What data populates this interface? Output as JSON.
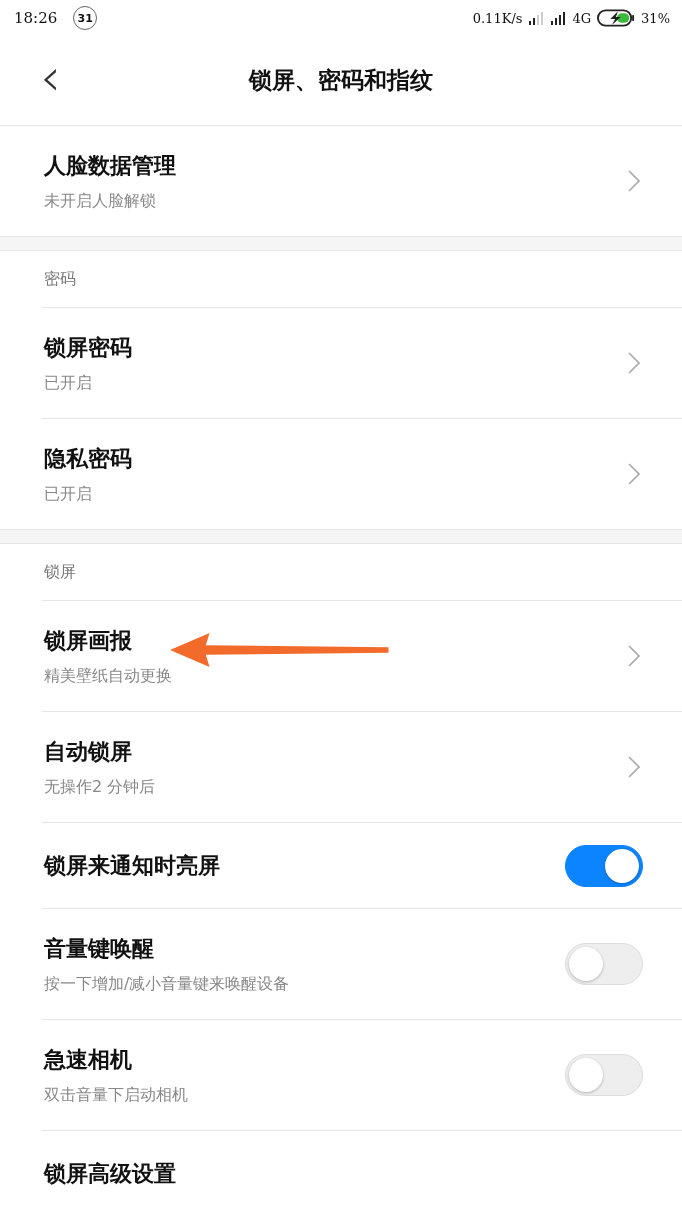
{
  "status_bar": {
    "time": "18:26",
    "badge": "31",
    "speed": "0.11K/s",
    "network": "4G",
    "battery": "31%"
  },
  "header": {
    "back": "‹",
    "title": "锁屏、密码和指纹"
  },
  "sections": [
    {
      "items": [
        {
          "kind": "link",
          "title": "人脸数据管理",
          "subtitle": "未开启人脸解锁"
        }
      ]
    },
    {
      "heading": "密码",
      "items": [
        {
          "kind": "link",
          "title": "锁屏密码",
          "subtitle": "已开启"
        },
        {
          "kind": "link",
          "title": "隐私密码",
          "subtitle": "已开启"
        }
      ]
    },
    {
      "heading": "锁屏",
      "items": [
        {
          "kind": "link",
          "title": "锁屏画报",
          "subtitle": "精美壁纸自动更换",
          "annotated": true
        },
        {
          "kind": "link",
          "title": "自动锁屏",
          "subtitle": "无操作2 分钟后"
        },
        {
          "kind": "toggle",
          "title": "锁屏来通知时亮屏",
          "on": true
        },
        {
          "kind": "toggle",
          "title": "音量键唤醒",
          "subtitle": "按一下增加/减小音量键来唤醒设备",
          "on": false
        },
        {
          "kind": "toggle",
          "title": "急速相机",
          "subtitle": "双击音量下启动相机",
          "on": false
        },
        {
          "kind": "plain",
          "title": "锁屏高级设置"
        }
      ]
    }
  ]
}
